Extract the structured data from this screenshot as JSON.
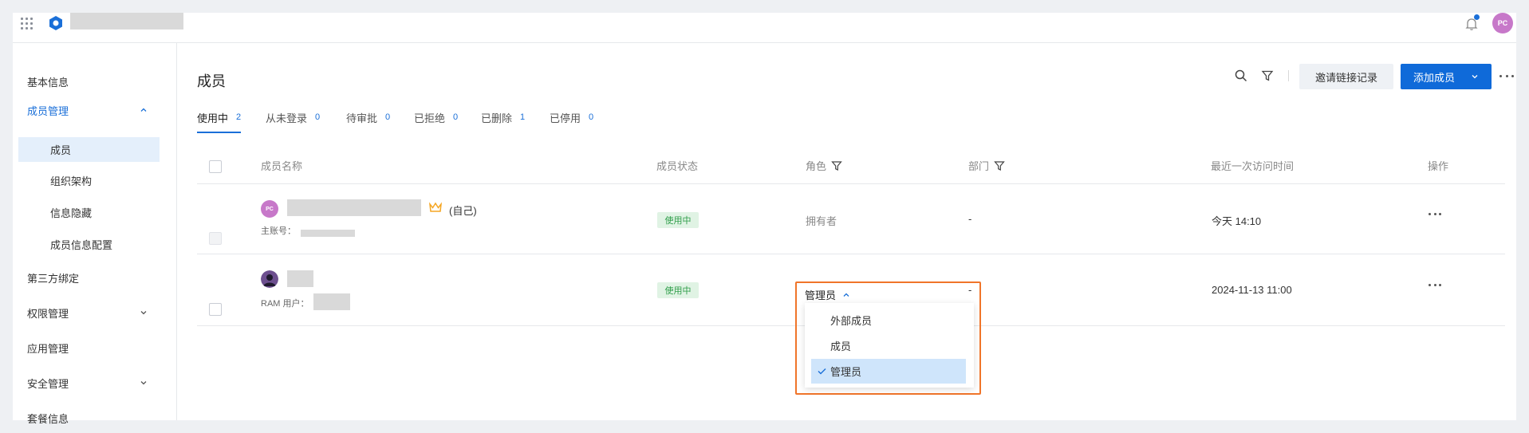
{
  "sidebar": {
    "items": [
      {
        "label": "基本信息"
      },
      {
        "label": "成员管理",
        "expanded": true
      },
      {
        "label": "第三方绑定"
      },
      {
        "label": "权限管理"
      },
      {
        "label": "应用管理"
      },
      {
        "label": "安全管理"
      },
      {
        "label": "套餐信息"
      }
    ],
    "sub_items": [
      {
        "label": "成员",
        "selected": true
      },
      {
        "label": "组织架构"
      },
      {
        "label": "信息隐藏"
      },
      {
        "label": "成员信息配置"
      }
    ]
  },
  "header": {
    "user_initials": "PC",
    "notification_dot": true
  },
  "page": {
    "title": "成员",
    "invite_log_button": "邀请链接记录",
    "add_member_button": "添加成员"
  },
  "tabs": [
    {
      "label": "使用中",
      "count": "2",
      "active": true
    },
    {
      "label": "从未登录",
      "count": "0"
    },
    {
      "label": "待审批",
      "count": "0"
    },
    {
      "label": "已拒绝",
      "count": "0"
    },
    {
      "label": "已删除",
      "count": "1"
    },
    {
      "label": "已停用",
      "count": "0"
    }
  ],
  "table": {
    "columns": {
      "name": "成员名称",
      "status": "成员状态",
      "role": "角色",
      "dept": "部门",
      "last_visit": "最近一次访问时间",
      "actions": "操作"
    },
    "rows": [
      {
        "avatar_initials": "PC",
        "self_tag": "(自己)",
        "sub_label": "主账号：",
        "status": "使用中",
        "role": "拥有者",
        "dept": "-",
        "last_visit": "今天 14:10"
      },
      {
        "sub_label": "RAM 用户：",
        "status": "使用中",
        "role": "管理员",
        "dept": "-",
        "last_visit": "2024-11-13 11:00"
      }
    ]
  },
  "role_dropdown": {
    "options": [
      {
        "label": "外部成员"
      },
      {
        "label": "成员"
      },
      {
        "label": "管理员",
        "selected": true
      }
    ]
  },
  "colors": {
    "accent": "#0f6ad9",
    "highlight": "#f0752a",
    "status_green": "#2f9e4a",
    "avatar_pink": "#c778c9"
  }
}
